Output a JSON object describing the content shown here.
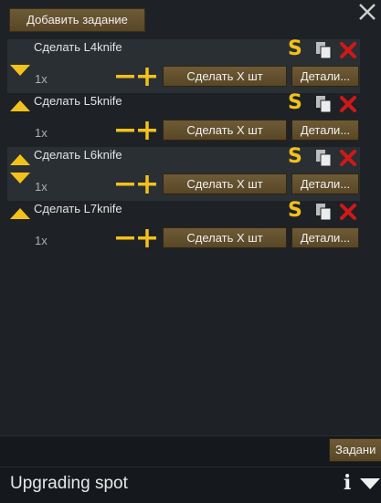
{
  "header": {
    "add_bill_label": "Добавить задание"
  },
  "bills": [
    {
      "title": "Сделать L4knife",
      "count": "1x",
      "make_label": "Сделать X шт",
      "details_label": "Детали...",
      "show_up": false,
      "show_down": true
    },
    {
      "title": "Сделать L5knife",
      "count": "1x",
      "make_label": "Сделать X шт",
      "details_label": "Детали...",
      "show_up": true,
      "show_down": false
    },
    {
      "title": "Сделать L6knife",
      "count": "1x",
      "make_label": "Сделать X шт",
      "details_label": "Детали...",
      "show_up": true,
      "show_down": true
    },
    {
      "title": "Сделать L7knife",
      "count": "1x",
      "make_label": "Сделать X шт",
      "details_label": "Детали...",
      "show_up": true,
      "show_down": false
    }
  ],
  "icons": {
    "store": "S",
    "info": "i"
  },
  "footer": {
    "tasks_label": "Задани",
    "title": "Upgrading spot"
  },
  "colors": {
    "accent_yellow": "#f3c11b",
    "delete_red": "#d01818",
    "button_brown": "#62502e"
  }
}
